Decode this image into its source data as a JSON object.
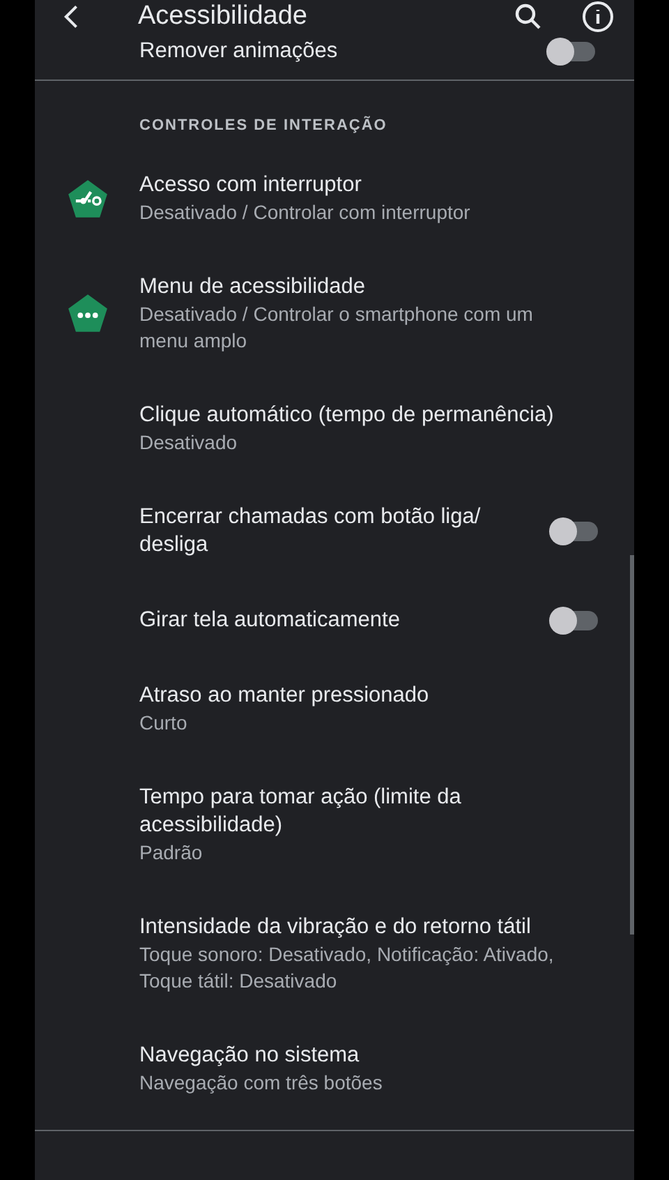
{
  "header": {
    "title": "Acessibilidade"
  },
  "top_setting": {
    "title": "Remover animações",
    "on": false
  },
  "section": {
    "title": "CONTROLES DE INTERAÇÃO"
  },
  "settings": [
    {
      "kind": "switch",
      "title": "Acesso com interruptor",
      "subtitle": "Desativado / Controlar com interruptor"
    },
    {
      "kind": "menu",
      "title": "Menu de acessibilidade",
      "subtitle": "Desativado / Controlar o smartphone com um menu amplo"
    },
    {
      "kind": "item",
      "title": "Clique automático (tempo de permanência)",
      "subtitle": "Desativado"
    },
    {
      "kind": "toggle",
      "title": "Encerrar chamadas com botão liga/ desliga",
      "on": false
    },
    {
      "kind": "toggle",
      "title": "Girar tela automaticamente",
      "on": false
    },
    {
      "kind": "item",
      "title": "Atraso ao manter pressionado",
      "subtitle": "Curto"
    },
    {
      "kind": "item",
      "title": "Tempo para tomar ação (limite da acessibilidade)",
      "subtitle": "Padrão"
    },
    {
      "kind": "item",
      "title": "Intensidade da vibração e do retorno tátil",
      "subtitle": "Toque sonoro: Desativado, Notificação: Ativado, Toque tátil: Desativado"
    },
    {
      "kind": "item",
      "title": "Navegação no sistema",
      "subtitle": "Navegação com três botões"
    }
  ]
}
